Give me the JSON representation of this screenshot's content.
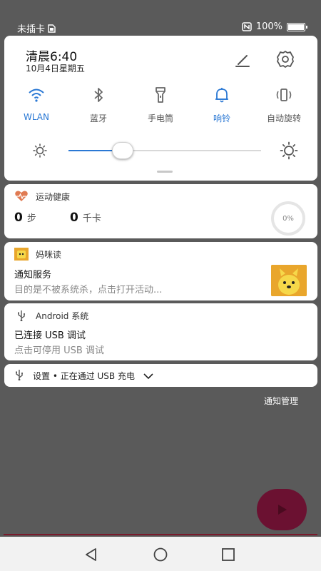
{
  "status_bar": {
    "carrier": "未插卡",
    "battery_text": "100%",
    "battery_level": 1.0,
    "nfc_icon": "nfc-icon",
    "sim_icon": "sim-icon"
  },
  "quick_settings": {
    "time": "清晨6:40",
    "date": "10月4日星期五",
    "edit_icon": "edit-icon",
    "settings_icon": "gear-icon",
    "tiles": [
      {
        "label": "WLAN",
        "icon": "wifi-icon",
        "active": true
      },
      {
        "label": "蓝牙",
        "icon": "bluetooth-icon",
        "active": false
      },
      {
        "label": "手电筒",
        "icon": "flashlight-icon",
        "active": false
      },
      {
        "label": "响铃",
        "icon": "bell-icon",
        "active": true
      },
      {
        "label": "自动旋转",
        "icon": "auto-rotate-icon",
        "active": false
      }
    ],
    "brightness_level": 0.28
  },
  "notifications": {
    "health": {
      "app": "运动健康",
      "steps_value": "0",
      "steps_unit": "步",
      "cal_value": "0",
      "cal_unit": "千卡",
      "progress": "0%"
    },
    "mimidu": {
      "app": "妈咪读",
      "title": "通知服务",
      "text": "目的是不被系统杀，点击打开活动..."
    },
    "android": {
      "app": "Android 系统",
      "title": "已连接 USB 调试",
      "text": "点击可停用 USB 调试"
    },
    "usb": {
      "text": "设置 • 正在通过 USB 充电"
    }
  },
  "manage_label": "通知管理",
  "colors": {
    "accent": "#2a78d4",
    "health": "#e07a52",
    "fab": "#6b1131"
  }
}
